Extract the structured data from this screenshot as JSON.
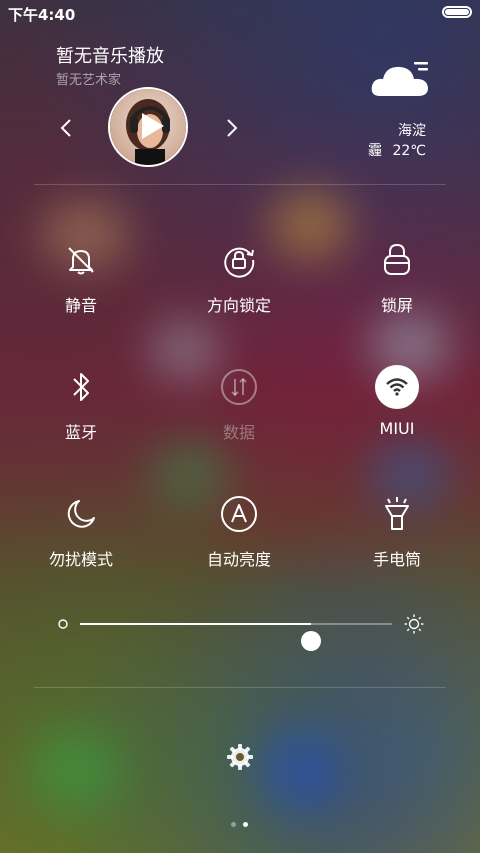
{
  "status_bar": {
    "time": "下午4:40",
    "battery_level": 1.0
  },
  "music": {
    "title": "暂无音乐播放",
    "artist": "暂无艺术家"
  },
  "weather": {
    "location": "海淀",
    "condition": "霾",
    "temperature": "22℃",
    "icon": "cloud-haze-icon"
  },
  "toggles": [
    {
      "label": "静音",
      "icon": "bell-muted-icon",
      "active": false
    },
    {
      "label": "方向锁定",
      "icon": "rotation-lock-icon",
      "active": false
    },
    {
      "label": "锁屏",
      "icon": "lock-icon",
      "active": false
    },
    {
      "label": "蓝牙",
      "icon": "bluetooth-icon",
      "active": false
    },
    {
      "label": "数据",
      "icon": "mobile-data-icon",
      "active": false,
      "disabled": true
    },
    {
      "label": "MIUI",
      "icon": "wifi-icon",
      "active": true
    },
    {
      "label": "勿扰模式",
      "icon": "moon-icon",
      "active": false
    },
    {
      "label": "自动亮度",
      "icon": "auto-brightness-icon",
      "active": false
    },
    {
      "label": "手电筒",
      "icon": "flashlight-icon",
      "active": false
    }
  ],
  "brightness": {
    "level": 0.74
  },
  "pager": {
    "pages": 2,
    "current": 2
  }
}
